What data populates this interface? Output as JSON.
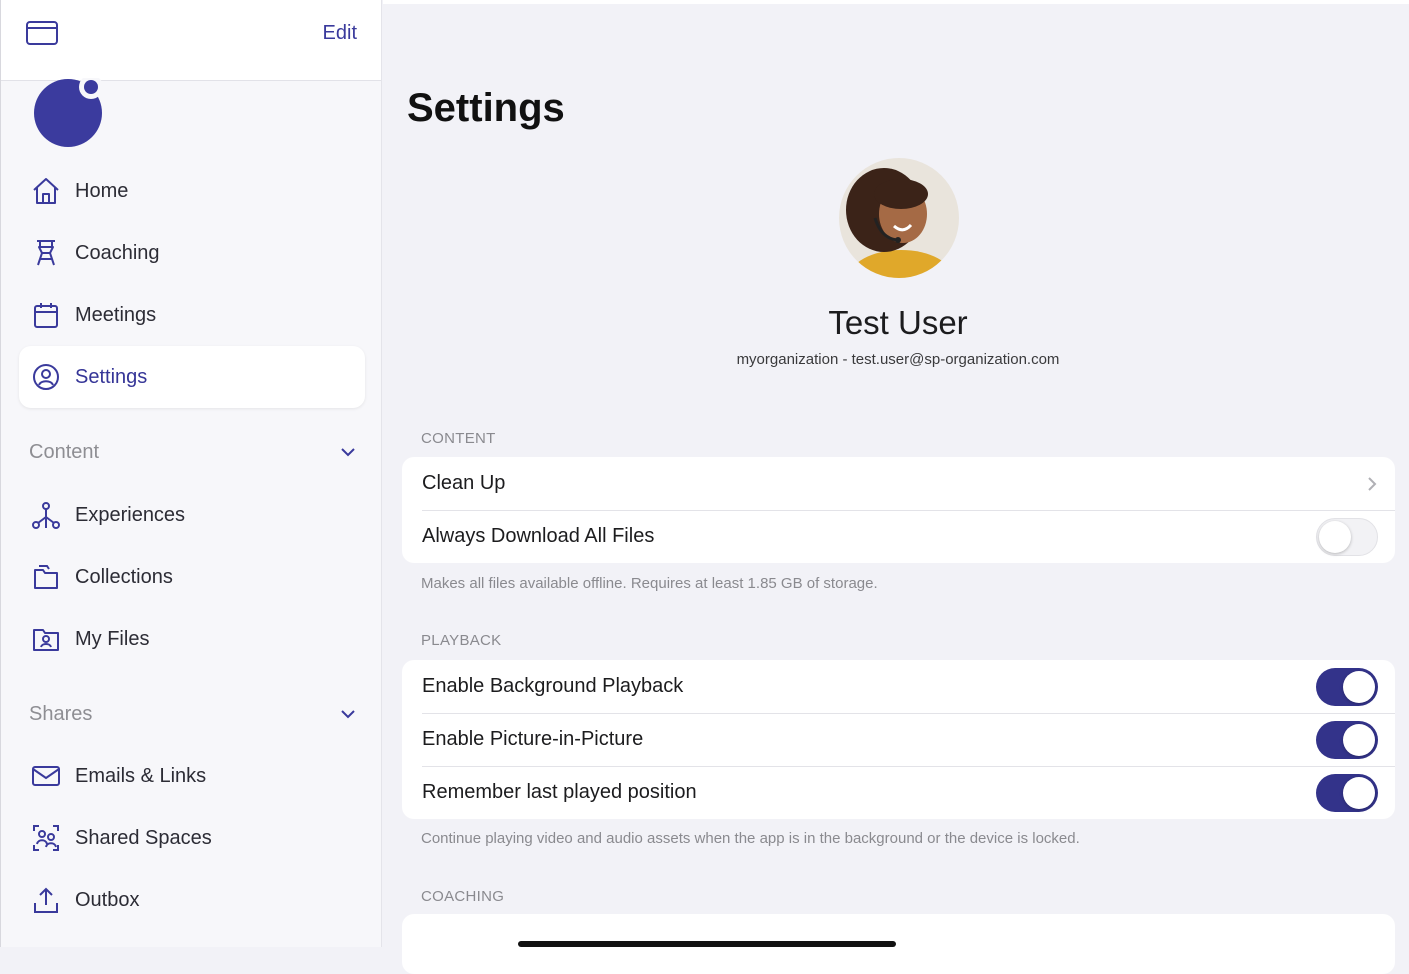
{
  "sidebar": {
    "edit_label": "Edit",
    "nav": [
      {
        "label": "Home",
        "icon": "home-icon"
      },
      {
        "label": "Coaching",
        "icon": "coaching-icon"
      },
      {
        "label": "Meetings",
        "icon": "calendar-icon"
      },
      {
        "label": "Settings",
        "icon": "user-circle-icon",
        "active": true
      }
    ],
    "content_section": {
      "label": "Content",
      "items": [
        {
          "label": "Experiences",
          "icon": "experiences-icon"
        },
        {
          "label": "Collections",
          "icon": "collections-icon"
        },
        {
          "label": "My Files",
          "icon": "my-files-icon"
        }
      ]
    },
    "shares_section": {
      "label": "Shares",
      "items": [
        {
          "label": "Emails & Links",
          "icon": "mail-icon"
        },
        {
          "label": "Shared Spaces",
          "icon": "shared-spaces-icon"
        },
        {
          "label": "Outbox",
          "icon": "outbox-icon"
        }
      ]
    }
  },
  "main": {
    "title": "Settings",
    "user": {
      "name": "Test User",
      "email": "myorganization - test.user@sp-organization.com"
    },
    "content": {
      "header": "CONTENT",
      "clean_up": "Clean Up",
      "always_download": {
        "label": "Always Download All Files",
        "on": false
      },
      "footnote": "Makes all files available offline. Requires at least 1.85 GB of storage."
    },
    "playback": {
      "header": "PLAYBACK",
      "items": [
        {
          "label": "Enable Background Playback",
          "on": true
        },
        {
          "label": "Enable Picture-in-Picture",
          "on": true
        },
        {
          "label": "Remember last played position",
          "on": true
        }
      ],
      "footnote": "Continue playing video and audio assets when the app is in the background or the device is locked."
    },
    "coaching": {
      "header": "COACHING"
    }
  },
  "colors": {
    "accent": "#33338a",
    "logo": "#3b3b9e",
    "background": "#f2f2f7"
  }
}
